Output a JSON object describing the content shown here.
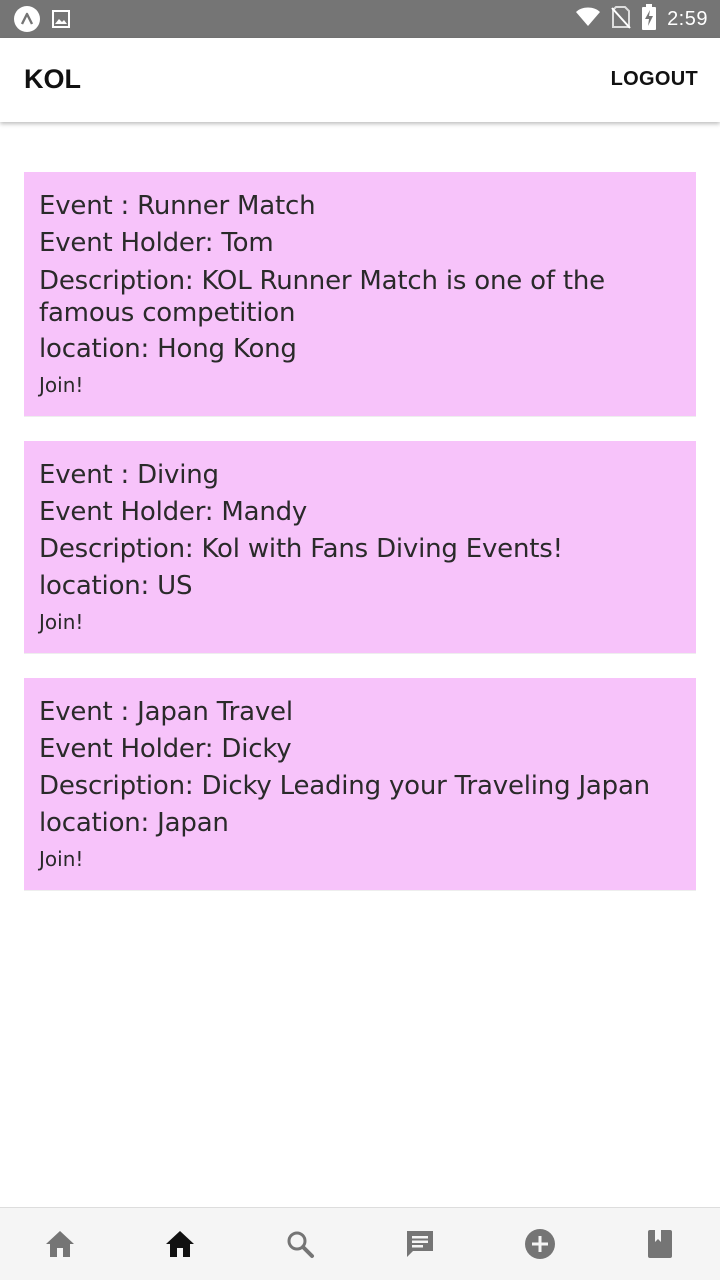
{
  "status_bar": {
    "time": "2:59",
    "icons": [
      "app-launcher-icon",
      "gallery-icon",
      "wifi-icon",
      "no-sim-icon",
      "battery-charging-icon"
    ]
  },
  "app_bar": {
    "title": "KOL",
    "logout_label": "LOGOUT"
  },
  "events": [
    {
      "event_line": "Event : Runner Match",
      "holder_line": "Event Holder: Tom",
      "description_line": "Description: KOL Runner Match is one of the famous competition",
      "location_line": "location: Hong Kong",
      "join_label": "Join!"
    },
    {
      "event_line": "Event : Diving",
      "holder_line": "Event Holder: Mandy",
      "description_line": "Description: Kol with Fans Diving Events!",
      "location_line": "location: US",
      "join_label": "Join!"
    },
    {
      "event_line": "Event : Japan Travel",
      "holder_line": "Event Holder: Dicky",
      "description_line": "Description: Dicky Leading your Traveling Japan",
      "location_line": "location: Japan",
      "join_label": "Join!"
    }
  ],
  "bottom_nav": {
    "items": [
      "home-icon",
      "home-icon",
      "search-icon",
      "chat-icon",
      "add-circle-icon",
      "book-icon"
    ],
    "active_index": 1
  },
  "colors": {
    "status_bar": "#757575",
    "card_background": "#f7c3fa",
    "nav_active": "#111111",
    "nav_inactive": "#757575"
  }
}
